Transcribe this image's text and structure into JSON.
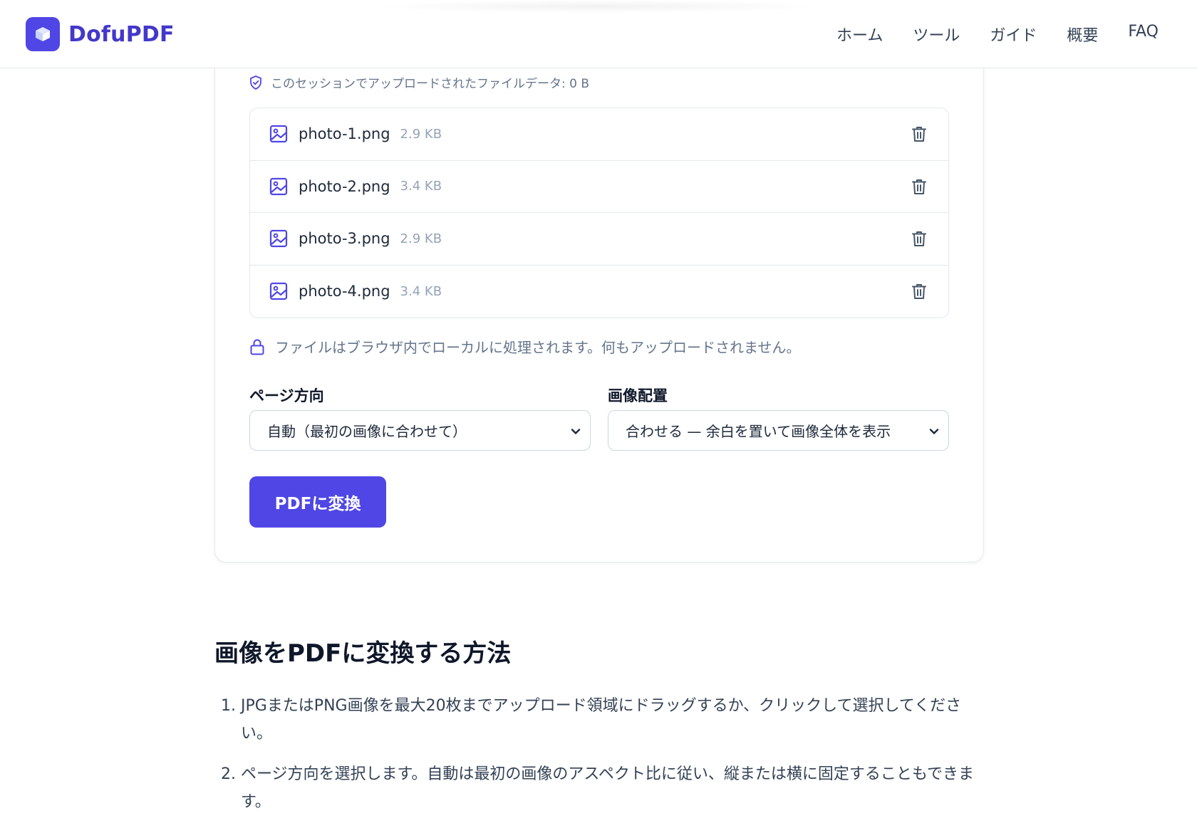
{
  "header": {
    "logo_text": "DofuPDF",
    "nav": [
      "ホーム",
      "ツール",
      "ガイド",
      "概要",
      "FAQ"
    ]
  },
  "session_note": "このセッションでアップロードされたファイルデータ: 0 B",
  "files": [
    {
      "name": "photo-1.png",
      "size": "2.9 KB"
    },
    {
      "name": "photo-2.png",
      "size": "3.4 KB"
    },
    {
      "name": "photo-3.png",
      "size": "2.9 KB"
    },
    {
      "name": "photo-4.png",
      "size": "3.4 KB"
    }
  ],
  "local_note": "ファイルはブラウザ内でローカルに処理されます。何もアップロードされません。",
  "orientation": {
    "label": "ページ方向",
    "value": "自動（最初の画像に合わせて）"
  },
  "placement": {
    "label": "画像配置",
    "value": "合わせる — 余白を置いて画像全体を表示"
  },
  "convert_label": "PDFに変換",
  "how_to": {
    "title": "画像をPDFに変換する方法",
    "steps": [
      {
        "num": "1.",
        "text": "JPGまたはPNG画像を最大20枚までアップロード領域にドラッグするか、クリックして選択してください。"
      },
      {
        "num": "2.",
        "text": "ページ方向を選択します。自動は最初の画像のアスペクト比に従い、縦または横に固定することもできます。"
      }
    ]
  },
  "colors": {
    "accent": "#4f46e5",
    "accent_dark": "#4338ca",
    "muted": "#64748b"
  }
}
